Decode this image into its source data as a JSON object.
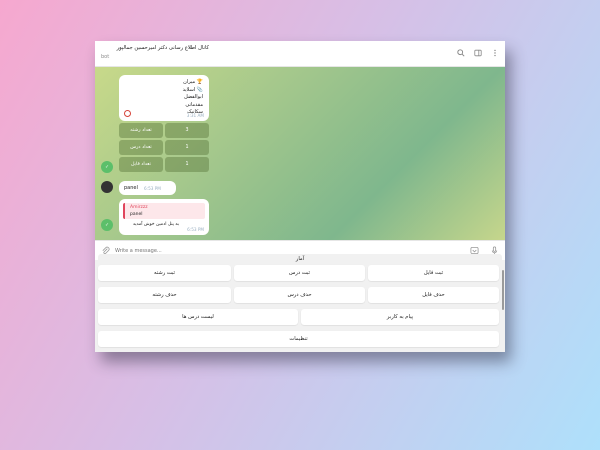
{
  "header": {
    "title": "کانال اطلاع رسانی دکتر امیرحسین جمالپور",
    "subtitle": "bot"
  },
  "card": {
    "lines": [
      "میران 🏆",
      "اسلاید 📎",
      "ابوالفضل",
      "مقدماتی",
      "سکانیک"
    ],
    "time": "3:31 AM"
  },
  "stats": [
    {
      "label": "تعداد رشته",
      "value": "3"
    },
    {
      "label": "تعداد درس",
      "value": "1"
    },
    {
      "label": "تعداد فایل",
      "value": "1"
    }
  ],
  "panel_msg": {
    "text": "panel",
    "time": "6:53 PM"
  },
  "reply": {
    "quote_name": "Amirzzz",
    "quote_text": "panel",
    "text": "به پنل ادمین خوش آمدید",
    "time": "6:53 PM"
  },
  "input": {
    "placeholder": "Write a message..."
  },
  "keyboard": {
    "title": "آمار",
    "row1": [
      "ثبت فایل",
      "ثبت درس",
      "ثبت رشته"
    ],
    "row2": [
      "حذف فایل",
      "حذف درس",
      "حذف رشته"
    ],
    "row3": [
      "پیام به کاربر",
      "لیست درس ها"
    ],
    "row4": "تنظیمات"
  },
  "colors": {
    "accent": "#e0455c",
    "bot_avatar": "#5cbf6a"
  }
}
